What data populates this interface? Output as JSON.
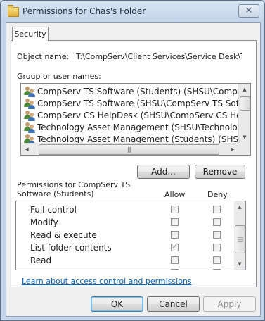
{
  "window": {
    "title": "Permissions for Chas's Folder",
    "close_glyph": "✕"
  },
  "tabs": [
    {
      "label": "Security"
    }
  ],
  "object": {
    "label": "Object name:",
    "value": "T:\\CompServ\\Client Services\\Service Desk\\Trainin"
  },
  "groups": {
    "label": "Group or user names:",
    "items": [
      {
        "label": "CompServ TS Software (Students) (SHSU\\CompServ TS S",
        "selected": true
      },
      {
        "label": "CompServ TS Software (SHSU\\CompServ TS Software)"
      },
      {
        "label": "CompServ CS HelpDesk (SHSU\\CompServ CS HelpDesk)"
      },
      {
        "label": "Technology Asset Management (SHSU\\Technology Asset"
      },
      {
        "label": "Technology Asset Management (Students) (SHSU\\Techno"
      }
    ]
  },
  "buttons": {
    "add": "Add...",
    "remove": "Remove",
    "ok": "OK",
    "cancel": "Cancel",
    "apply": "Apply"
  },
  "permissions": {
    "label": "Permissions for CompServ TS Software (Students)",
    "allow_header": "Allow",
    "deny_header": "Deny",
    "rows": [
      {
        "name": "Full control",
        "allow": false,
        "deny": false
      },
      {
        "name": "Modify",
        "allow": false,
        "deny": false
      },
      {
        "name": "Read & execute",
        "allow": false,
        "deny": false
      },
      {
        "name": "List folder contents",
        "allow": true,
        "deny": false
      },
      {
        "name": "Read",
        "allow": false,
        "deny": false
      }
    ]
  },
  "link": {
    "text": "Learn about access control and permissions"
  },
  "icons": {
    "folder": "folder-icon",
    "user": "user-group-icon"
  }
}
